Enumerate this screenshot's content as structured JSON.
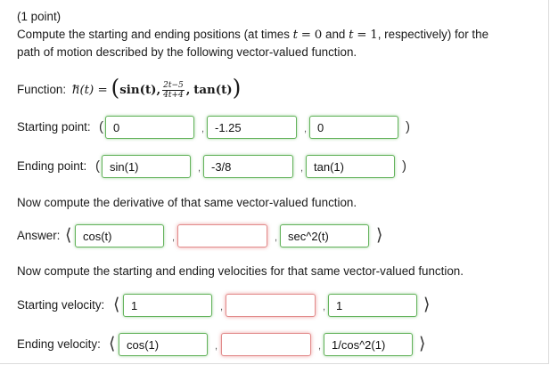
{
  "header": {
    "points": "(1 point)",
    "intro_a": "Compute the starting and ending positions (at times",
    "intro_var": "t",
    "intro_eq": "=",
    "intro_v0": "0",
    "intro_and": "and",
    "intro_var2": "t",
    "intro_eq2": "=",
    "intro_v1": "1",
    "intro_b": ", respectively) for the",
    "intro_line2": "path of motion described by the following vector-valued function."
  },
  "function": {
    "label": "Function:",
    "lhs": "h(t) =",
    "arrow": "→",
    "open": "(",
    "sin": "sin(t),",
    "frac_num": "2t−5",
    "frac_den": "4t+4",
    "comma": ",",
    "tan": "tan(t)",
    "close": ")"
  },
  "starting_point": {
    "label": "Starting point:",
    "open": "(",
    "close": ")",
    "values": [
      "0",
      "-1.25",
      "0"
    ]
  },
  "ending_point": {
    "label": "Ending point:",
    "open": "(",
    "close": ")",
    "values": [
      "sin(1)",
      "-3/8",
      "tan(1)"
    ]
  },
  "derivative_prompt": "Now compute the derivative of that same vector-valued function.",
  "answer": {
    "label": "Answer:",
    "open": "⟨",
    "close": "⟩",
    "values": [
      "cos(t)",
      "",
      "sec^2(t)"
    ]
  },
  "velocity_prompt": "Now compute the starting and ending velocities for that same vector-valued function.",
  "starting_velocity": {
    "label": "Starting velocity:",
    "open": "⟨",
    "close": "⟩",
    "values": [
      "1",
      "",
      "1"
    ]
  },
  "ending_velocity": {
    "label": "Ending velocity:",
    "open": "⟨",
    "close": "⟩",
    "values": [
      "cos(1)",
      "",
      "1/cos^2(1)"
    ]
  },
  "separator": ",",
  "colors": {
    "correct": "#64b35c",
    "incorrect": "#e28b8b"
  }
}
